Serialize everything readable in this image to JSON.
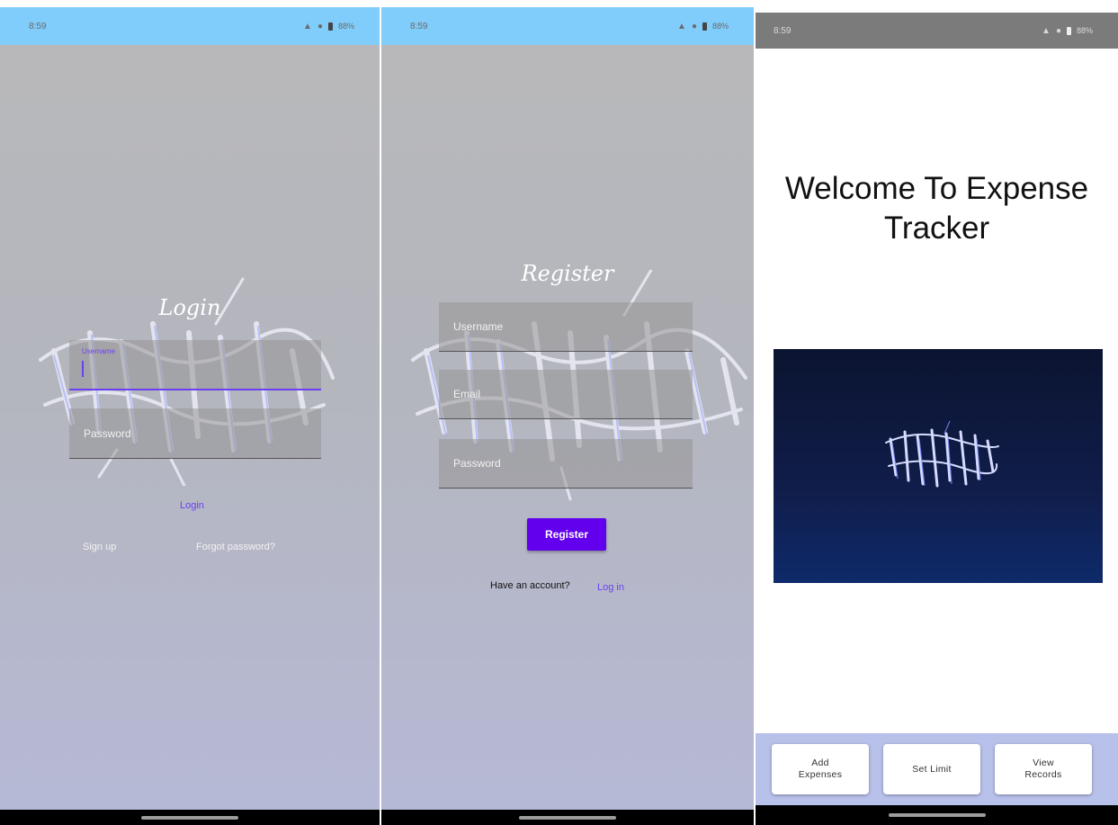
{
  "login_screen": {
    "status": {
      "time": "8:59",
      "battery": "88%"
    },
    "title": "Login",
    "username": {
      "label": "Username"
    },
    "password": {
      "placeholder": "Password"
    },
    "login_button": "Login",
    "signup_link": "Sign up",
    "forgot_link": "Forgot password?"
  },
  "register_screen": {
    "status": {
      "time": "8:59",
      "battery": "88%"
    },
    "title": "Register",
    "username": {
      "placeholder": "Username"
    },
    "email": {
      "placeholder": "Email"
    },
    "password": {
      "placeholder": "Password"
    },
    "register_button": "Register",
    "have_account": "Have an account?",
    "login_link": "Log in"
  },
  "home_screen": {
    "status": {
      "time": "8:59",
      "battery": "88%"
    },
    "welcome": "Welcome To Expense Tracker",
    "actions": [
      {
        "label": "Add\nExpenses"
      },
      {
        "label": "Set Limit"
      },
      {
        "label": "View\nRecords"
      }
    ]
  },
  "colors": {
    "accent": "#6200ee",
    "statusbar_auth": "#80cdfb",
    "statusbar_home": "#7b7b7b",
    "bottom_bar": "#b8c1ea"
  },
  "icons": [
    "wifi-icon",
    "signal-icon",
    "battery-icon",
    "logo-graffiti-icon"
  ]
}
